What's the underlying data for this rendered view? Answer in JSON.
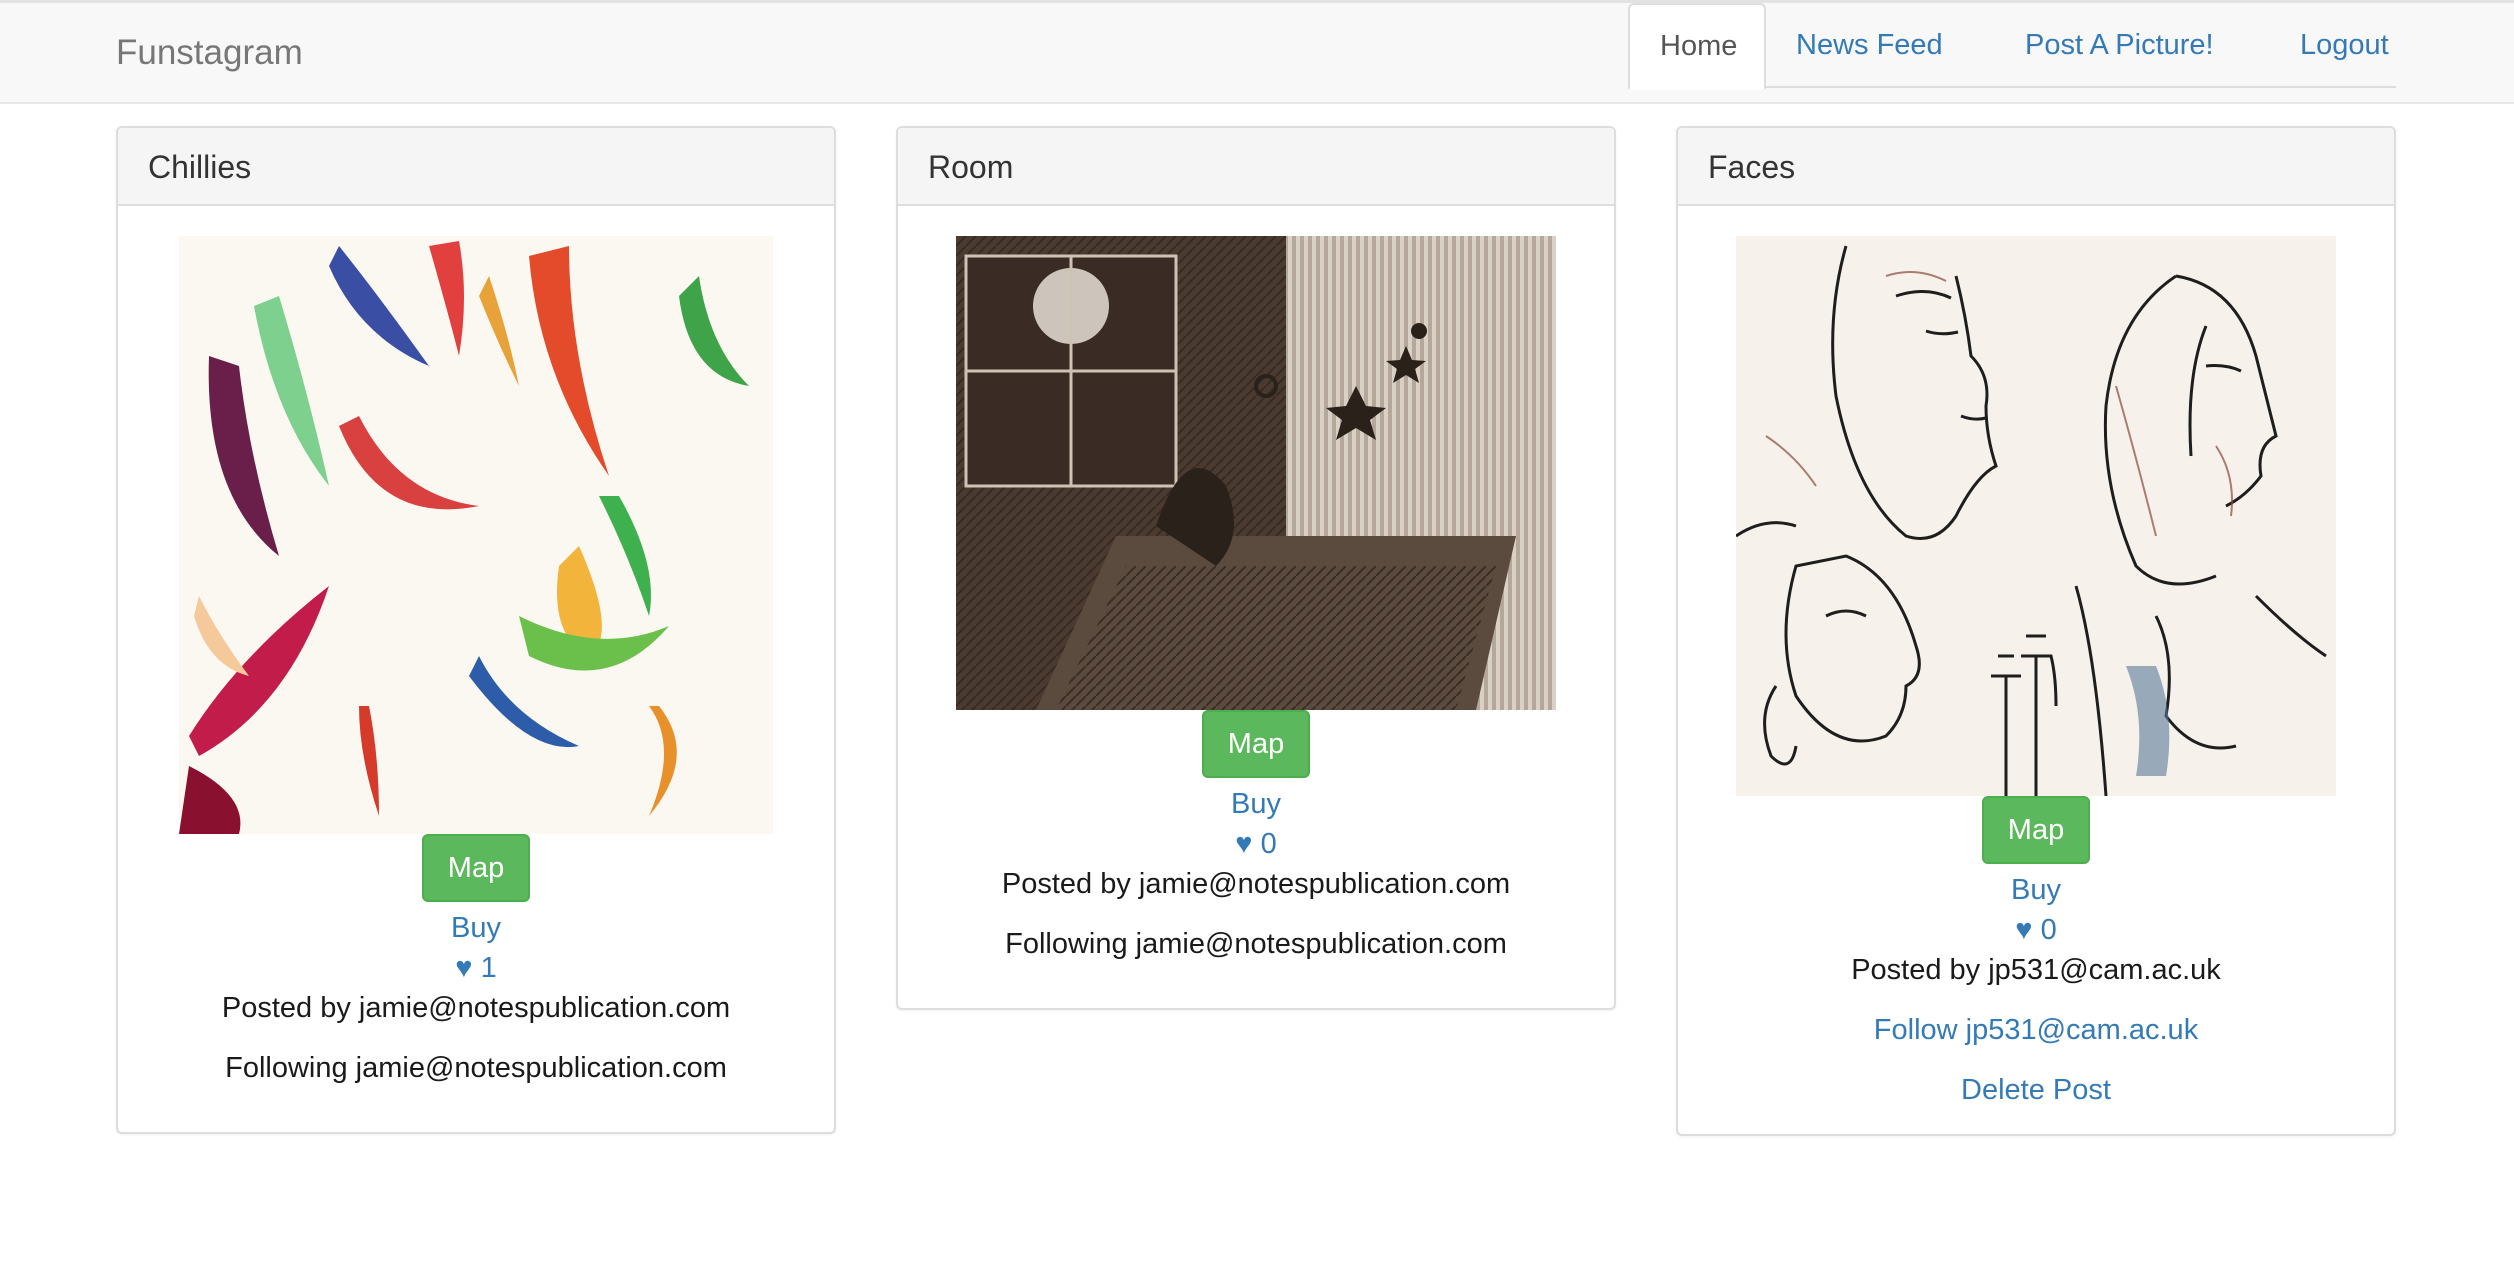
{
  "navbar": {
    "brand": "Funstagram",
    "items": [
      {
        "label": "Home",
        "active": true
      },
      {
        "label": "News Feed",
        "active": false
      },
      {
        "label": "Post A Picture!",
        "active": false
      },
      {
        "label": "Logout",
        "active": false
      }
    ]
  },
  "posts": [
    {
      "title": "Chillies",
      "map_label": "Map",
      "buy_label": "Buy",
      "likes": "♥ 1",
      "posted_by": "Posted by jamie@notespublication.com",
      "follow_text": "Following jamie@notespublication.com",
      "image_icon": "chillies-painting"
    },
    {
      "title": "Room",
      "map_label": "Map",
      "buy_label": "Buy",
      "likes": "♥ 0",
      "posted_by": "Posted by jamie@notespublication.com",
      "follow_text": "Following jamie@notespublication.com",
      "image_icon": "room-sketch"
    },
    {
      "title": "Faces",
      "map_label": "Map",
      "buy_label": "Buy",
      "likes": "♥ 0",
      "posted_by": "Posted by jp531@cam.ac.uk",
      "follow_link": "Follow jp531@cam.ac.uk",
      "delete_label": "Delete Post",
      "image_icon": "faces-drawing"
    }
  ],
  "colors": {
    "link": "#337ab7",
    "button_success": "#5cb85c",
    "panel_heading_bg": "#f5f5f5",
    "navbar_bg": "#f8f8f8"
  }
}
